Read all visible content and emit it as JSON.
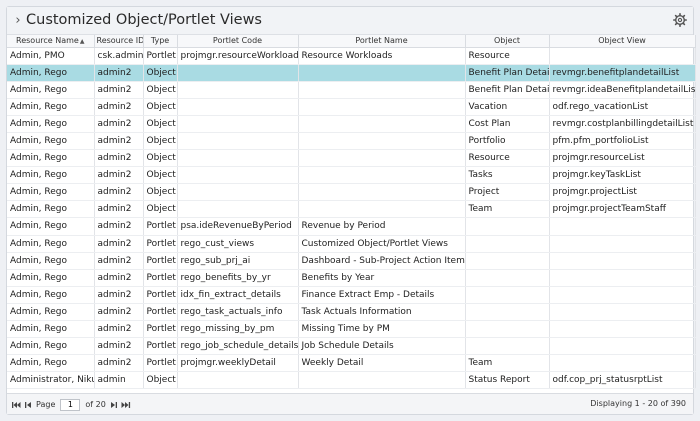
{
  "header": {
    "title": "Customized Object/Portlet Views",
    "chevron_icon": "chevron-right-icon",
    "settings_icon": "gear-icon"
  },
  "columns": [
    "Resource Name",
    "Resource ID",
    "Type",
    "Portlet Code",
    "Portlet Name",
    "Object",
    "Object View"
  ],
  "sort": {
    "column": "Resource Name",
    "direction": "ascending"
  },
  "selected_row": 1,
  "rows": [
    [
      "Admin, PMO",
      "csk.admin",
      "Portlet",
      "projmgr.resourceWorkloads",
      "Resource Workloads",
      "Resource",
      ""
    ],
    [
      "Admin, Rego",
      "admin2",
      "Object",
      "",
      "",
      "Benefit Plan Detail",
      "revmgr.benefitplandetailList"
    ],
    [
      "Admin, Rego",
      "admin2",
      "Object",
      "",
      "",
      "Benefit Plan Detail",
      "revmgr.ideaBenefitplandetailList"
    ],
    [
      "Admin, Rego",
      "admin2",
      "Object",
      "",
      "",
      "Vacation",
      "odf.rego_vacationList"
    ],
    [
      "Admin, Rego",
      "admin2",
      "Object",
      "",
      "",
      "Cost Plan",
      "revmgr.costplanbillingdetailList"
    ],
    [
      "Admin, Rego",
      "admin2",
      "Object",
      "",
      "",
      "Portfolio",
      "pfm.pfm_portfolioList"
    ],
    [
      "Admin, Rego",
      "admin2",
      "Object",
      "",
      "",
      "Resource",
      "projmgr.resourceList"
    ],
    [
      "Admin, Rego",
      "admin2",
      "Object",
      "",
      "",
      "Tasks",
      "projmgr.keyTaskList"
    ],
    [
      "Admin, Rego",
      "admin2",
      "Object",
      "",
      "",
      "Project",
      "projmgr.projectList"
    ],
    [
      "Admin, Rego",
      "admin2",
      "Object",
      "",
      "",
      "Team",
      "projmgr.projectTeamStaff"
    ],
    [
      "Admin, Rego",
      "admin2",
      "Portlet",
      "psa.ideRevenueByPeriod",
      "Revenue by Period",
      "",
      ""
    ],
    [
      "Admin, Rego",
      "admin2",
      "Portlet",
      "rego_cust_views",
      "Customized Object/Portlet Views",
      "",
      ""
    ],
    [
      "Admin, Rego",
      "admin2",
      "Portlet",
      "rego_sub_prj_ai",
      "Dashboard - Sub-Project Action Items",
      "",
      ""
    ],
    [
      "Admin, Rego",
      "admin2",
      "Portlet",
      "rego_benefits_by_yr",
      "Benefits by Year",
      "",
      ""
    ],
    [
      "Admin, Rego",
      "admin2",
      "Portlet",
      "idx_fin_extract_details",
      "Finance Extract Emp - Details",
      "",
      ""
    ],
    [
      "Admin, Rego",
      "admin2",
      "Portlet",
      "rego_task_actuals_info",
      "Task Actuals Information",
      "",
      ""
    ],
    [
      "Admin, Rego",
      "admin2",
      "Portlet",
      "rego_missing_by_pm",
      "Missing Time by PM",
      "",
      ""
    ],
    [
      "Admin, Rego",
      "admin2",
      "Portlet",
      "rego_job_schedule_details",
      "Job Schedule Details",
      "",
      ""
    ],
    [
      "Admin, Rego",
      "admin2",
      "Portlet",
      "projmgr.weeklyDetail",
      "Weekly Detail",
      "Team",
      ""
    ],
    [
      "Administrator, Niku",
      "admin",
      "Object",
      "",
      "",
      "Status Report",
      "odf.cop_prj_statusrptList"
    ]
  ],
  "pager": {
    "page_label": "Page",
    "page_value": "1",
    "of_label": "of 20",
    "first_icon": "first-page-icon",
    "prev_icon": "previous-page-icon",
    "next_icon": "next-page-icon",
    "last_icon": "last-page-icon"
  },
  "displaying": "Displaying 1 - 20 of 390"
}
